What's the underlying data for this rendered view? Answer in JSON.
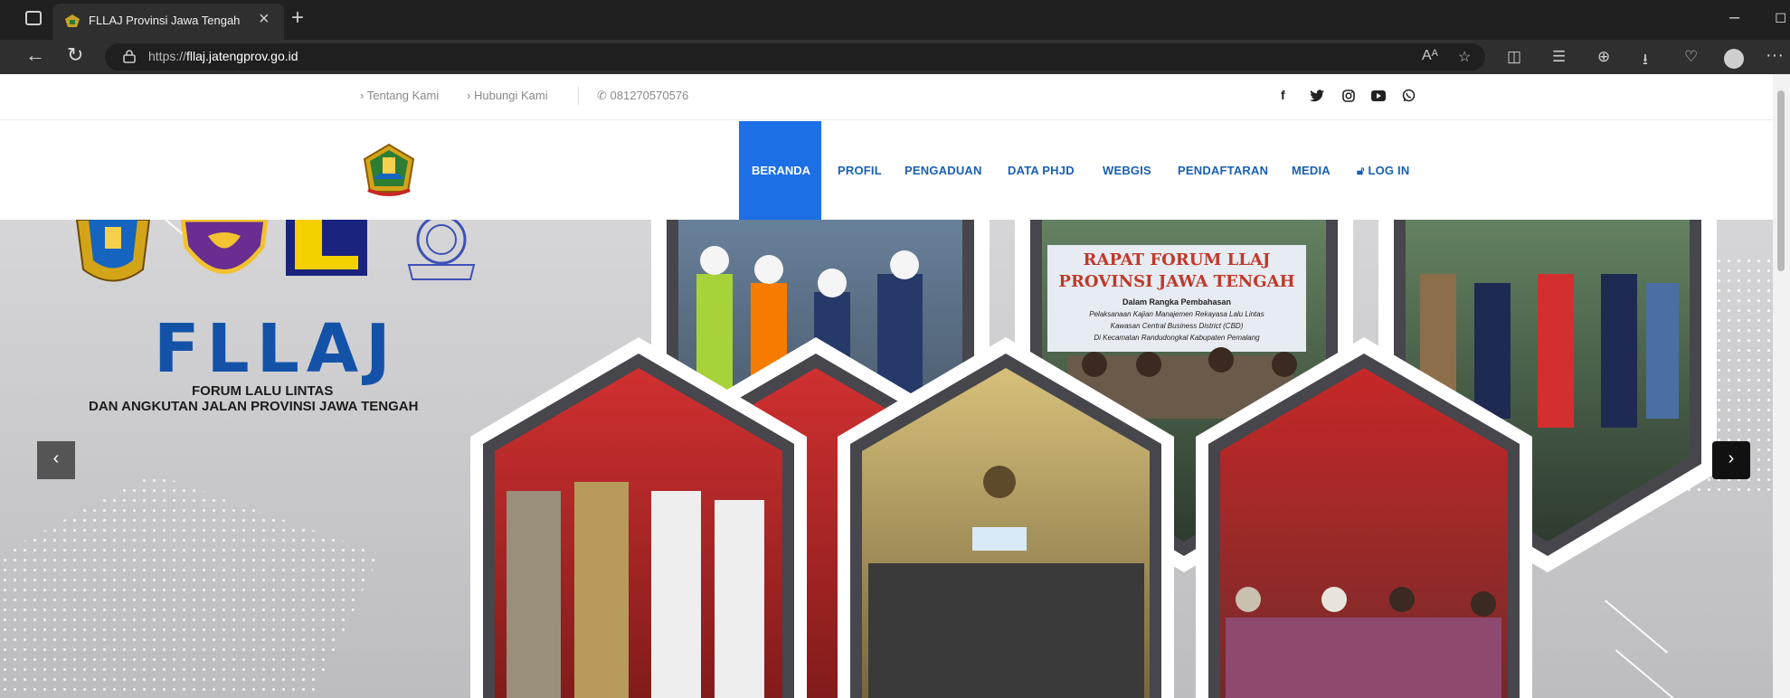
{
  "browser": {
    "tab_title": "FLLAJ Provinsi Jawa Tengah",
    "tab_close": "×",
    "tab_new": "+",
    "url_scheme": "https://",
    "url_host": "fllaj.jatengprov.go.id",
    "win_minimize": "–",
    "more": "···",
    "icons": [
      "back-arrow-icon",
      "reload-icon",
      "lock-icon",
      "read-aloud-icon",
      "favorite-star-icon",
      "split-screen-icon",
      "favorites-icon",
      "collections-icon",
      "downloads-icon",
      "heartbeat-icon",
      "profile-icon"
    ]
  },
  "topbar": {
    "links": [
      "Tentang Kami",
      "Hubungi Kami"
    ],
    "chevron": "›",
    "phone": "081270570576",
    "social": [
      "facebook-icon",
      "twitter-icon",
      "instagram-icon",
      "youtube-icon",
      "whatsapp-icon"
    ]
  },
  "nav": {
    "items": [
      "BERANDA",
      "PROFIL",
      "PENGADUAN",
      "DATA PHJD",
      "WEBGIS",
      "PENDAFTARAN",
      "MEDIA",
      "LOG IN"
    ],
    "active": "BERANDA"
  },
  "hero": {
    "brand": "FLLAJ",
    "subtitle_line1": "FORUM LALU LINTAS",
    "subtitle_line2": "DAN ANGKUTAN JALAN PROVINSI JAWA TENGAH",
    "prev": "‹",
    "next": "›",
    "banner_title_1": "RAPAT FORUM LLAJ",
    "banner_title_2": "PROVINSI JAWA TENGAH",
    "banner_body": [
      "Dalam Rangka Pembahasan",
      "Pelaksanaan Kajian Manajemen Rekayasa Lalu Lintas",
      "Kawasan Central Business District (CBD)",
      "Di Kecamatan Randudongkal Kabupaten Pemalang"
    ]
  },
  "colors": {
    "brand_blue": "#1452a8",
    "nav_blue": "#1a5fb4",
    "active_bg": "#1d6fe6"
  }
}
